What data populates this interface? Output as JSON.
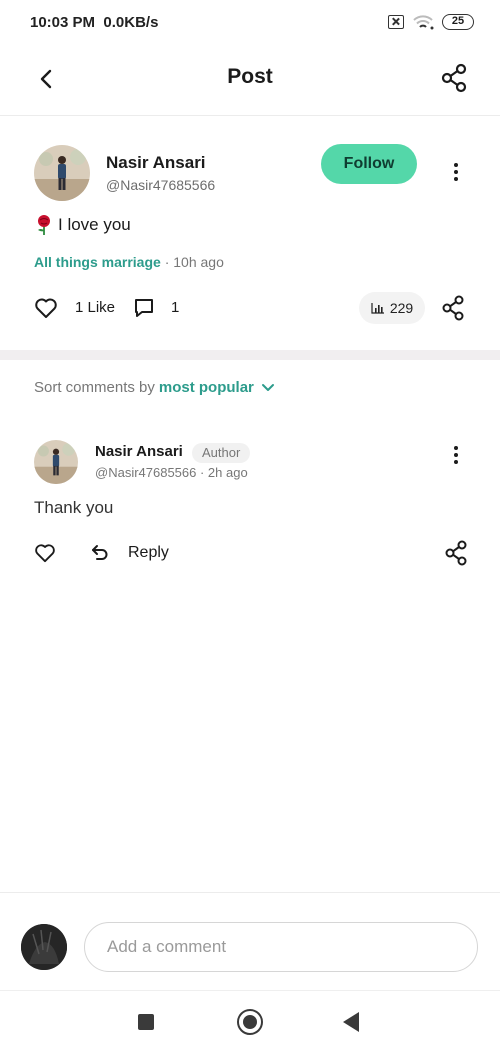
{
  "status_bar": {
    "time": "10:03 PM",
    "network_speed": "0.0KB/s",
    "battery": "25"
  },
  "header": {
    "title": "Post"
  },
  "post": {
    "author_name": "Nasir Ansari",
    "author_handle": "@Nasir47685566",
    "follow_label": "Follow",
    "text": "I love you",
    "community": "All things marriage",
    "time_ago": " · 10h ago",
    "like_count": "1 Like",
    "comment_count": "1",
    "view_count": "229"
  },
  "sort": {
    "prefix": "Sort comments by",
    "value": "most popular"
  },
  "comment": {
    "author_name": "Nasir Ansari",
    "badge": "Author",
    "meta": "@Nasir47685566 · 2h ago",
    "text": "Thank you",
    "reply_label": "Reply"
  },
  "composer": {
    "placeholder": "Add a comment"
  },
  "colors": {
    "accent": "#54d7a9",
    "link": "#2d9c8c",
    "divider": "#f1eef0"
  },
  "icons": [
    "back-arrow-icon",
    "share-icon",
    "more-vertical-icon",
    "rose-icon",
    "heart-icon",
    "comment-bubble-icon",
    "bar-chart-icon",
    "chevron-down-icon",
    "reply-icon"
  ]
}
